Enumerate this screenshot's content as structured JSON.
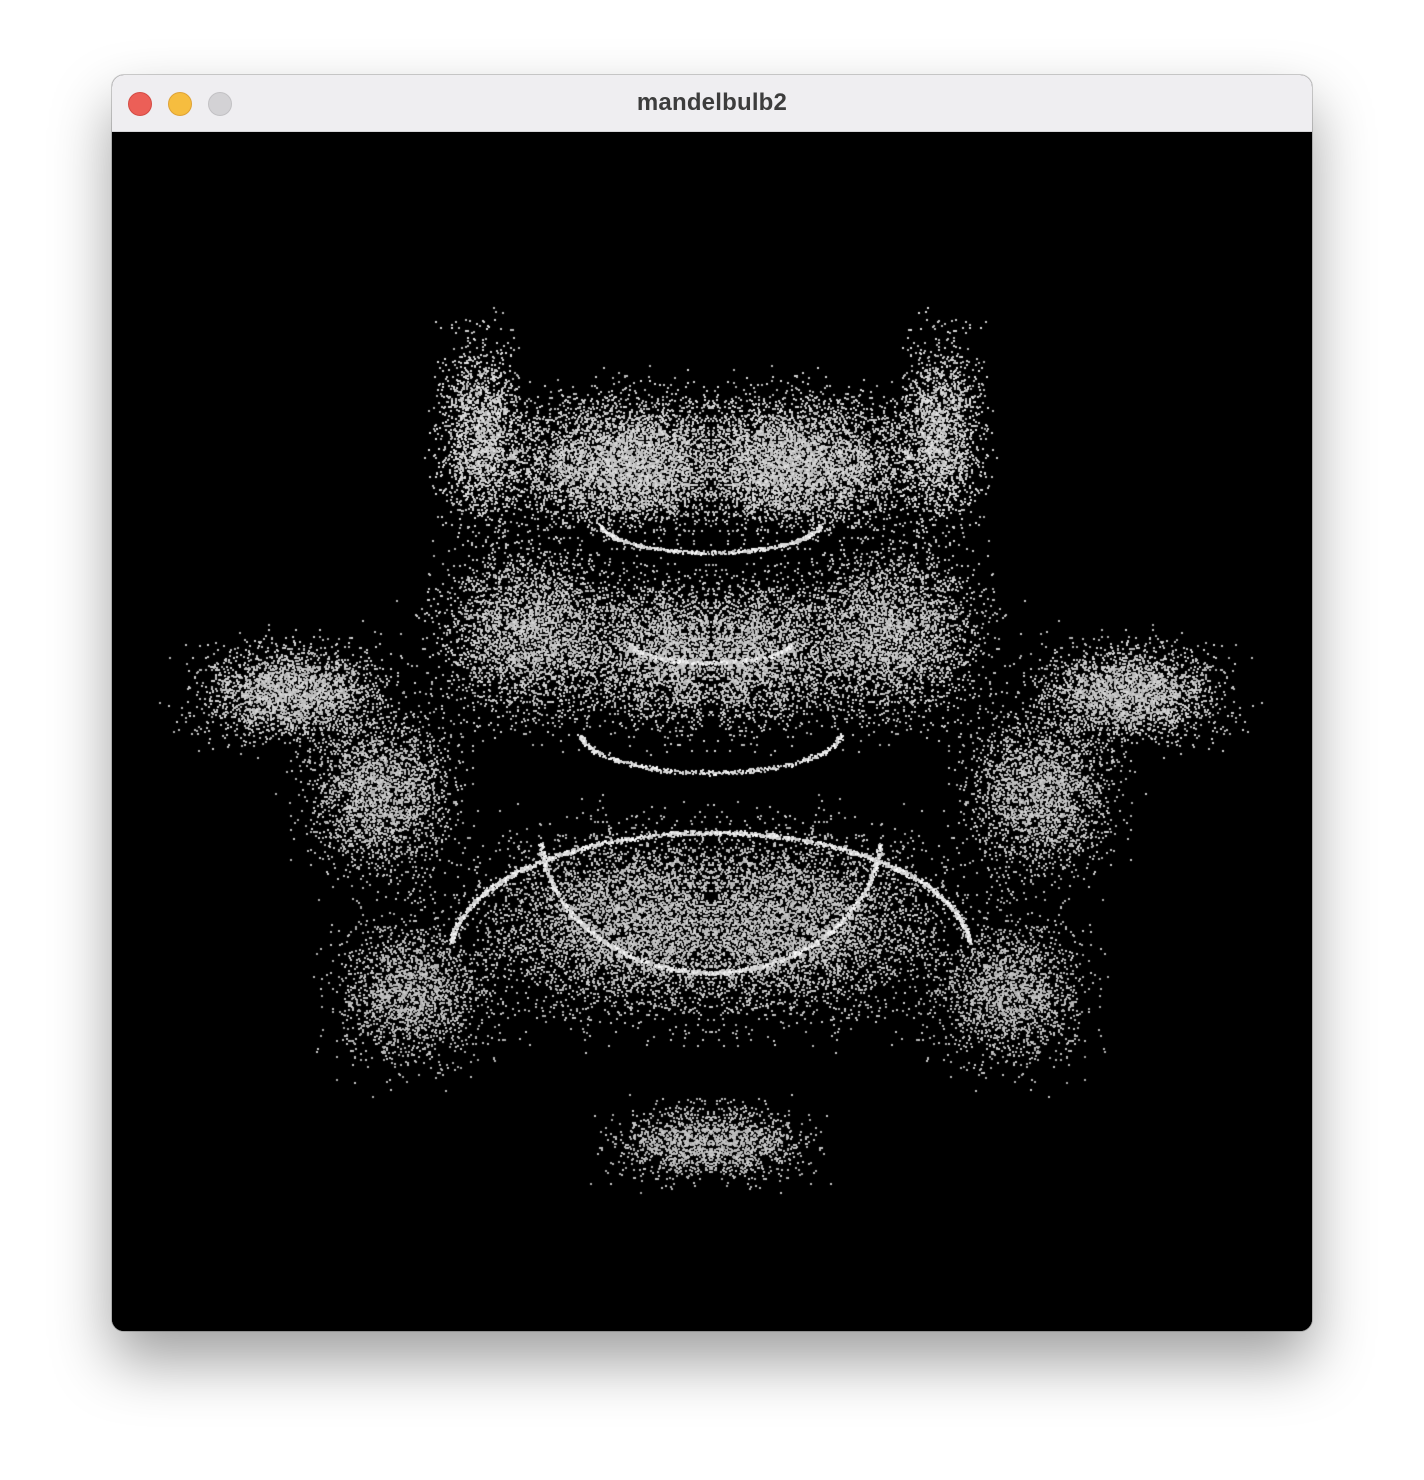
{
  "window": {
    "title": "mandelbulb2",
    "controls": {
      "close_color": "#ec5f57",
      "minimize_color": "#f6bd3f",
      "zoom_color": "#d3d2d5"
    }
  },
  "canvas": {
    "background": "#000000",
    "point_color": "#ffffff",
    "content": "mandelbulb-point-cloud"
  }
}
